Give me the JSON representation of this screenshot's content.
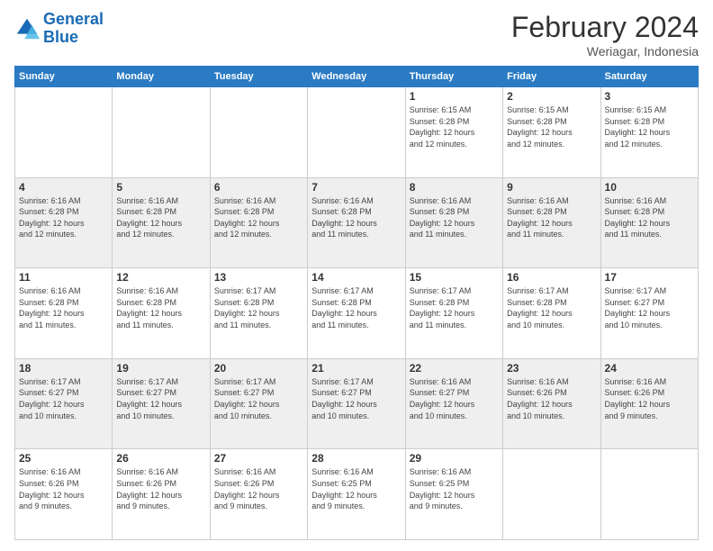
{
  "header": {
    "logo_line1": "General",
    "logo_line2": "Blue",
    "title": "February 2024",
    "subtitle": "Weriagar, Indonesia"
  },
  "weekdays": [
    "Sunday",
    "Monday",
    "Tuesday",
    "Wednesday",
    "Thursday",
    "Friday",
    "Saturday"
  ],
  "weeks": [
    [
      {
        "day": "",
        "info": ""
      },
      {
        "day": "",
        "info": ""
      },
      {
        "day": "",
        "info": ""
      },
      {
        "day": "",
        "info": ""
      },
      {
        "day": "1",
        "info": "Sunrise: 6:15 AM\nSunset: 6:28 PM\nDaylight: 12 hours\nand 12 minutes."
      },
      {
        "day": "2",
        "info": "Sunrise: 6:15 AM\nSunset: 6:28 PM\nDaylight: 12 hours\nand 12 minutes."
      },
      {
        "day": "3",
        "info": "Sunrise: 6:15 AM\nSunset: 6:28 PM\nDaylight: 12 hours\nand 12 minutes."
      }
    ],
    [
      {
        "day": "4",
        "info": "Sunrise: 6:16 AM\nSunset: 6:28 PM\nDaylight: 12 hours\nand 12 minutes."
      },
      {
        "day": "5",
        "info": "Sunrise: 6:16 AM\nSunset: 6:28 PM\nDaylight: 12 hours\nand 12 minutes."
      },
      {
        "day": "6",
        "info": "Sunrise: 6:16 AM\nSunset: 6:28 PM\nDaylight: 12 hours\nand 12 minutes."
      },
      {
        "day": "7",
        "info": "Sunrise: 6:16 AM\nSunset: 6:28 PM\nDaylight: 12 hours\nand 11 minutes."
      },
      {
        "day": "8",
        "info": "Sunrise: 6:16 AM\nSunset: 6:28 PM\nDaylight: 12 hours\nand 11 minutes."
      },
      {
        "day": "9",
        "info": "Sunrise: 6:16 AM\nSunset: 6:28 PM\nDaylight: 12 hours\nand 11 minutes."
      },
      {
        "day": "10",
        "info": "Sunrise: 6:16 AM\nSunset: 6:28 PM\nDaylight: 12 hours\nand 11 minutes."
      }
    ],
    [
      {
        "day": "11",
        "info": "Sunrise: 6:16 AM\nSunset: 6:28 PM\nDaylight: 12 hours\nand 11 minutes."
      },
      {
        "day": "12",
        "info": "Sunrise: 6:16 AM\nSunset: 6:28 PM\nDaylight: 12 hours\nand 11 minutes."
      },
      {
        "day": "13",
        "info": "Sunrise: 6:17 AM\nSunset: 6:28 PM\nDaylight: 12 hours\nand 11 minutes."
      },
      {
        "day": "14",
        "info": "Sunrise: 6:17 AM\nSunset: 6:28 PM\nDaylight: 12 hours\nand 11 minutes."
      },
      {
        "day": "15",
        "info": "Sunrise: 6:17 AM\nSunset: 6:28 PM\nDaylight: 12 hours\nand 11 minutes."
      },
      {
        "day": "16",
        "info": "Sunrise: 6:17 AM\nSunset: 6:28 PM\nDaylight: 12 hours\nand 10 minutes."
      },
      {
        "day": "17",
        "info": "Sunrise: 6:17 AM\nSunset: 6:27 PM\nDaylight: 12 hours\nand 10 minutes."
      }
    ],
    [
      {
        "day": "18",
        "info": "Sunrise: 6:17 AM\nSunset: 6:27 PM\nDaylight: 12 hours\nand 10 minutes."
      },
      {
        "day": "19",
        "info": "Sunrise: 6:17 AM\nSunset: 6:27 PM\nDaylight: 12 hours\nand 10 minutes."
      },
      {
        "day": "20",
        "info": "Sunrise: 6:17 AM\nSunset: 6:27 PM\nDaylight: 12 hours\nand 10 minutes."
      },
      {
        "day": "21",
        "info": "Sunrise: 6:17 AM\nSunset: 6:27 PM\nDaylight: 12 hours\nand 10 minutes."
      },
      {
        "day": "22",
        "info": "Sunrise: 6:16 AM\nSunset: 6:27 PM\nDaylight: 12 hours\nand 10 minutes."
      },
      {
        "day": "23",
        "info": "Sunrise: 6:16 AM\nSunset: 6:26 PM\nDaylight: 12 hours\nand 10 minutes."
      },
      {
        "day": "24",
        "info": "Sunrise: 6:16 AM\nSunset: 6:26 PM\nDaylight: 12 hours\nand 9 minutes."
      }
    ],
    [
      {
        "day": "25",
        "info": "Sunrise: 6:16 AM\nSunset: 6:26 PM\nDaylight: 12 hours\nand 9 minutes."
      },
      {
        "day": "26",
        "info": "Sunrise: 6:16 AM\nSunset: 6:26 PM\nDaylight: 12 hours\nand 9 minutes."
      },
      {
        "day": "27",
        "info": "Sunrise: 6:16 AM\nSunset: 6:26 PM\nDaylight: 12 hours\nand 9 minutes."
      },
      {
        "day": "28",
        "info": "Sunrise: 6:16 AM\nSunset: 6:25 PM\nDaylight: 12 hours\nand 9 minutes."
      },
      {
        "day": "29",
        "info": "Sunrise: 6:16 AM\nSunset: 6:25 PM\nDaylight: 12 hours\nand 9 minutes."
      },
      {
        "day": "",
        "info": ""
      },
      {
        "day": "",
        "info": ""
      }
    ]
  ]
}
